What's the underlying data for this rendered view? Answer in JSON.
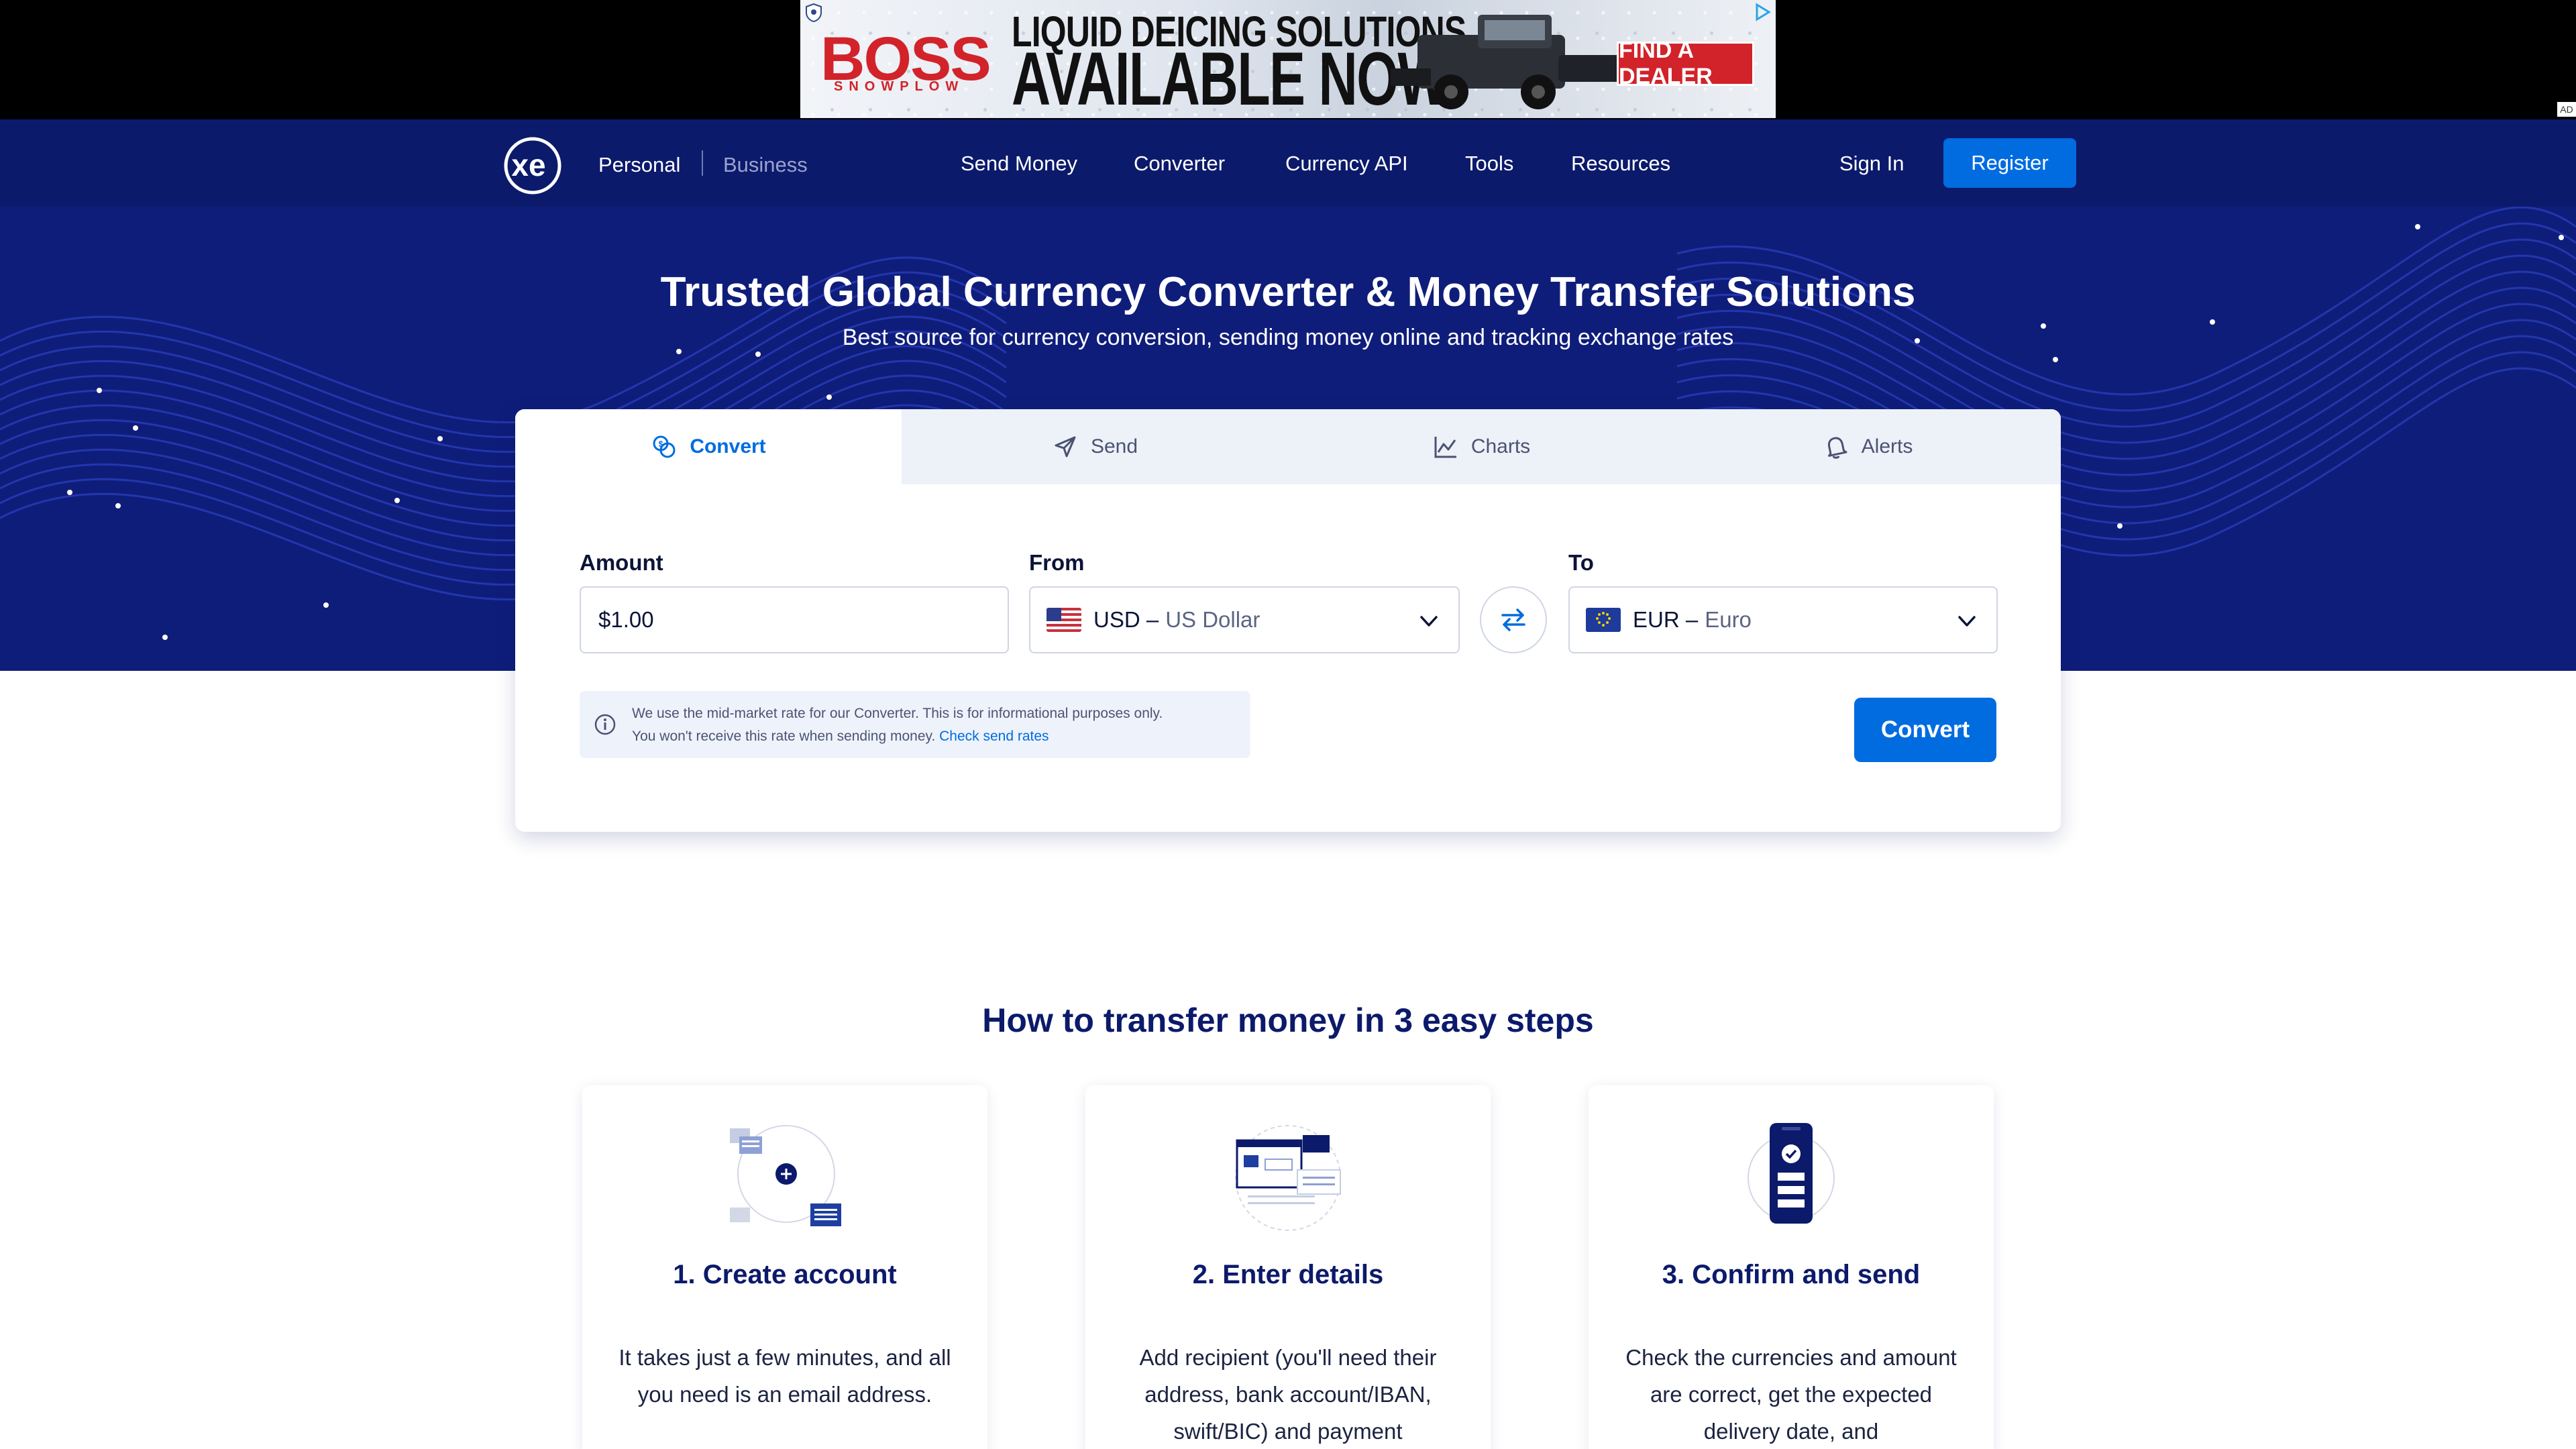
{
  "ad": {
    "brand": "BOSS",
    "brand_sub": "SNOWPLOW",
    "headline_1": "LIQUID DEICING SOLUTIONS",
    "headline_2": "AVAILABLE NOW",
    "cta": "FIND A DEALER",
    "tag": "AD"
  },
  "nav": {
    "personal": "Personal",
    "business": "Business",
    "links": [
      "Send Money",
      "Converter",
      "Currency API",
      "Tools",
      "Resources"
    ],
    "sign_in": "Sign In",
    "register": "Register"
  },
  "hero": {
    "title": "Trusted Global Currency Converter & Money Transfer Solutions",
    "subtitle": "Best source for currency conversion, sending money online and tracking exchange rates"
  },
  "converter": {
    "tabs": [
      {
        "label": "Convert",
        "icon": "convert-icon",
        "active": true
      },
      {
        "label": "Send",
        "icon": "send-icon",
        "active": false
      },
      {
        "label": "Charts",
        "icon": "charts-icon",
        "active": false
      },
      {
        "label": "Alerts",
        "icon": "bell-icon",
        "active": false
      }
    ],
    "amount_label": "Amount",
    "amount_value": "$1.00",
    "from_label": "From",
    "from_code": "USD –",
    "from_name": "US Dollar",
    "to_label": "To",
    "to_code": "EUR –",
    "to_name": "Euro",
    "info_line1": "We use the mid-market rate for our Converter. This is for informational purposes only.",
    "info_line2": "You won't receive this rate when sending money.",
    "info_link": "Check send rates",
    "convert_button": "Convert"
  },
  "steps": {
    "title": "How to transfer money in 3 easy steps",
    "items": [
      {
        "heading": "1. Create account",
        "body": "It takes just a few minutes, and all you need is an email address."
      },
      {
        "heading": "2. Enter details",
        "body": "Add recipient (you'll need their address, bank account/IBAN, swift/BIC) and payment"
      },
      {
        "heading": "3. Confirm and send",
        "body": "Check the currencies and amount are correct, get the expected delivery date, and"
      }
    ]
  },
  "colors": {
    "navy": "#0c1a6b",
    "hero": "#0f1d7a",
    "primary_blue": "#006ce0",
    "card_tabs_bg": "#edf1f8",
    "ad_red": "#d2232a"
  }
}
